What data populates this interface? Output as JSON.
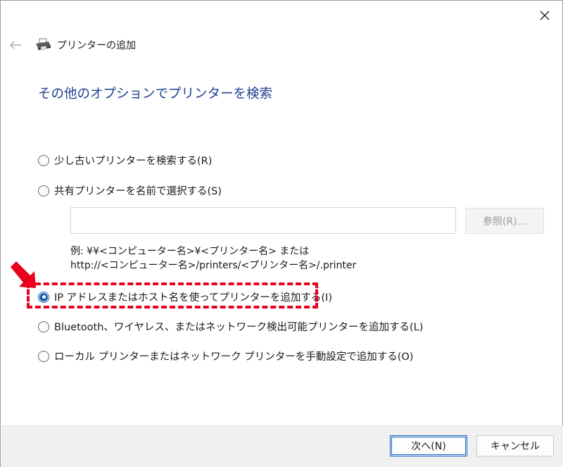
{
  "window": {
    "title": "プリンターの追加",
    "close_icon": "close-icon",
    "back_icon": "back-arrow-icon",
    "printer_icon": "printer-icon"
  },
  "main": {
    "heading": "その他のオプションでプリンターを検索",
    "options": [
      {
        "label": "少し古いプリンターを検索する(R)",
        "checked": false
      },
      {
        "label": "共有プリンターを名前で選択する(S)",
        "checked": false
      },
      {
        "label": "IP アドレスまたはホスト名を使ってプリンターを追加する(I)",
        "checked": true
      },
      {
        "label": "Bluetooth、ワイヤレス、またはネットワーク検出可能プリンターを追加する(L)",
        "checked": false
      },
      {
        "label": "ローカル プリンターまたはネットワーク プリンターを手動設定で追加する(O)",
        "checked": false
      }
    ],
    "share_name_value": "",
    "browse_label": "参照(R)...",
    "example_line1": "例: ¥¥<コンピューター名>¥<プリンター名> または",
    "example_line2": "http://<コンピューター名>/printers/<プリンター名>/.printer"
  },
  "annotation": {
    "highlight_color": "#e8001c",
    "arrow_icon": "red-arrow-icon"
  },
  "footer": {
    "next_label": "次へ(N)",
    "cancel_label": "キャンセル"
  },
  "colors": {
    "heading": "#1f3f8f",
    "accent": "#1c5fb0"
  }
}
